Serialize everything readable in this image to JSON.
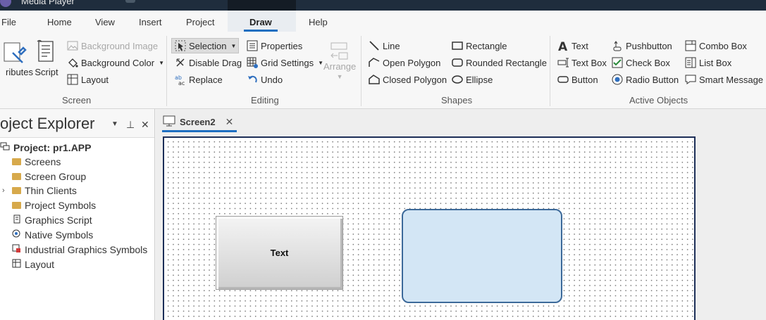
{
  "titlebar": {
    "title": "Media Player"
  },
  "menu": {
    "file": "File",
    "home": "Home",
    "view": "View",
    "insert": "Insert",
    "project": "Project",
    "draw": "Draw",
    "help": "Help"
  },
  "ribbon": {
    "screen": {
      "attributes_label": "ributes",
      "script_label": "Script",
      "background_image": "Background Image",
      "background_color": "Background Color",
      "layout": "Layout",
      "group": "Screen"
    },
    "editing": {
      "selection": "Selection",
      "disable_drag": "Disable Drag",
      "replace": "Replace",
      "properties": "Properties",
      "grid_settings": "Grid Settings",
      "undo": "Undo",
      "arrange": "Arrange",
      "group": "Editing"
    },
    "shapes": {
      "line": "Line",
      "open_polygon": "Open Polygon",
      "closed_polygon": "Closed Polygon",
      "rectangle": "Rectangle",
      "rounded_rectangle": "Rounded Rectangle",
      "ellipse": "Ellipse",
      "group": "Shapes"
    },
    "active_objects": {
      "text": "Text",
      "text_box": "Text Box",
      "button": "Button",
      "pushbutton": "Pushbutton",
      "check_box": "Check Box",
      "radio_button": "Radio Button",
      "combo_box": "Combo Box",
      "list_box": "List Box",
      "smart_message": "Smart Message",
      "group": "Active Objects"
    }
  },
  "explorer": {
    "title": "oject Explorer",
    "items": [
      {
        "label": "Project: pr1.APP"
      },
      {
        "label": "Screens"
      },
      {
        "label": "Screen Group"
      },
      {
        "label": "Thin Clients"
      },
      {
        "label": "Project Symbols"
      },
      {
        "label": "Graphics Script"
      },
      {
        "label": "Native Symbols"
      },
      {
        "label": "Industrial Graphics Symbols"
      },
      {
        "label": "Layout"
      }
    ]
  },
  "document": {
    "tab_label": "Screen2",
    "button_text": "Text"
  },
  "colors": {
    "accent": "#1e6fc1",
    "titlebar": "#1f2d3d",
    "rect_fill": "#d3e6f5",
    "rect_border": "#3d6a9a",
    "canvas_border": "#1c2e57"
  }
}
